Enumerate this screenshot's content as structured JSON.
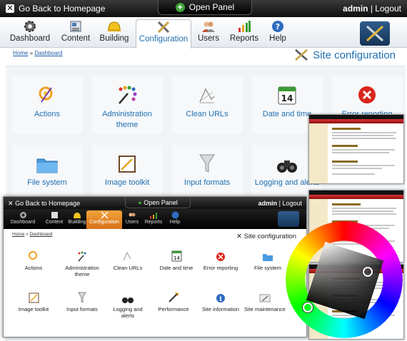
{
  "topbar": {
    "home_link": "Go Back to Homepage",
    "open_panel": "Open Panel",
    "user": "admin",
    "separator": "|",
    "logout": "Logout"
  },
  "nav": {
    "items": [
      {
        "label": "Dashboard",
        "icon": "gear-icon"
      },
      {
        "label": "Content",
        "icon": "content-icon"
      },
      {
        "label": "Building",
        "icon": "helmet-icon"
      },
      {
        "label": "Configuration",
        "icon": "tools-icon"
      },
      {
        "label": "Users",
        "icon": "users-icon"
      },
      {
        "label": "Reports",
        "icon": "bar-chart-icon"
      },
      {
        "label": "Help",
        "icon": "help-icon"
      }
    ],
    "active": "Configuration"
  },
  "breadcrumb": {
    "home": "Home",
    "sep": "»",
    "dashboard": "Dashboard"
  },
  "page_title": "Site configuration",
  "tiles": [
    {
      "label": "Actions",
      "icon": "actions-icon"
    },
    {
      "label": "Administration theme",
      "icon": "palette-icon"
    },
    {
      "label": "Clean URLs",
      "icon": "clean-urls-icon"
    },
    {
      "label": "Date and time",
      "icon": "calendar-icon",
      "day": "14"
    },
    {
      "label": "Error reporting",
      "icon": "error-icon"
    },
    {
      "label": "File system",
      "icon": "folder-icon"
    },
    {
      "label": "Image toolkit",
      "icon": "image-toolkit-icon"
    },
    {
      "label": "Input formats",
      "icon": "funnel-icon"
    },
    {
      "label": "Logging and alerts",
      "icon": "binoculars-icon"
    }
  ],
  "overlay": {
    "topbar": {
      "home_link": "Go Back to Homepage",
      "open_panel": "Open Panel",
      "user": "admin",
      "separator": "|",
      "logout": "Logout"
    },
    "nav": {
      "items": [
        "Dashboard",
        "Content",
        "Building",
        "Configuration",
        "Users",
        "Reports",
        "Help"
      ]
    },
    "breadcrumb": {
      "home": "Home",
      "sep": "»",
      "dashboard": "Dashboard"
    },
    "page_title": "Site configuration",
    "tiles_row1": [
      "Actions",
      "Administration theme",
      "Clean URLs",
      "Date and time",
      "Error reporting",
      "File system"
    ],
    "tiles_row2": [
      "Image toolkit",
      "Input formats",
      "Logging and alerts",
      "Performance",
      "Site information",
      "Site maintenance"
    ],
    "day": "14"
  },
  "colors": {
    "accent_blue": "#1f6fb1",
    "overlay_active": "#e88a2a",
    "green_plus": "#3ea33a"
  }
}
